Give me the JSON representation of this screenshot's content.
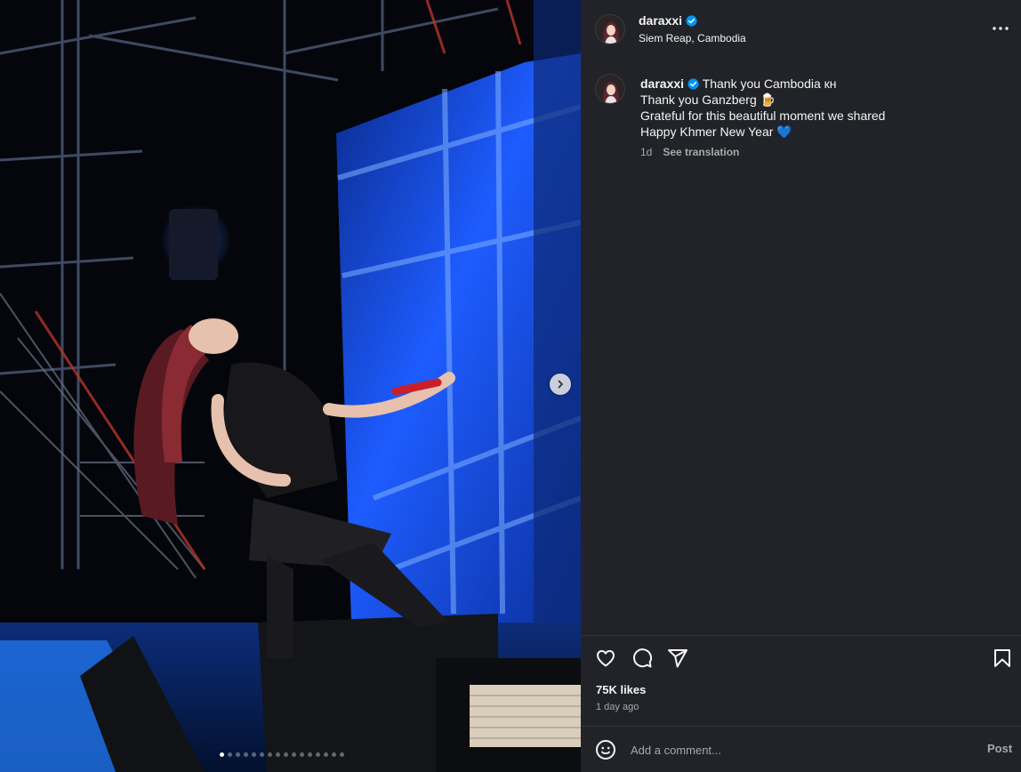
{
  "media": {
    "slide_count": 16,
    "active_slide": 1,
    "next_icon": "chevron-right-icon"
  },
  "header": {
    "username": "daraxxi",
    "location": "Siem Reap, Cambodia",
    "more_icon": "more-horizontal-icon"
  },
  "caption": {
    "username": "daraxxi",
    "lines": [
      "Thank you Cambodia кн",
      "Thank you Ganzberg 🍺",
      "Grateful for this beautiful moment we shared",
      "Happy Khmer New Year 💙"
    ],
    "time": "1d",
    "see_translation": "See translation"
  },
  "actions": {
    "icons": [
      "heart-icon",
      "comment-icon",
      "share-icon",
      "bookmark-icon"
    ]
  },
  "likes": "75K likes",
  "timestamp": "1 day ago",
  "comment": {
    "placeholder": "Add a comment...",
    "post_label": "Post"
  },
  "colors": {
    "panel_bg": "#212328",
    "verified": "#0095f6",
    "stage_blue": "#1e5cff"
  }
}
